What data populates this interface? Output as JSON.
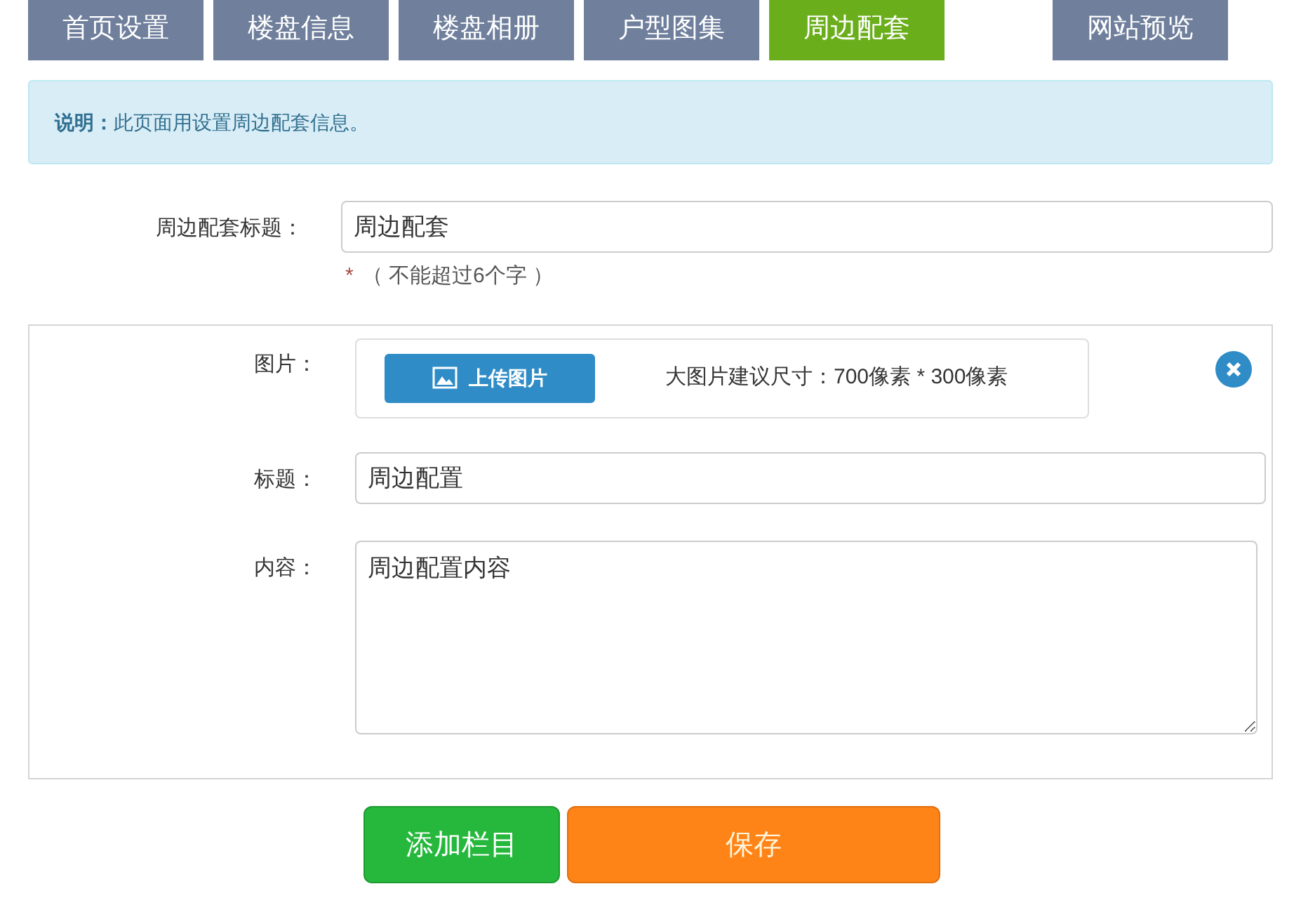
{
  "tabs": [
    {
      "label": "首页设置",
      "selected": false
    },
    {
      "label": "楼盘信息",
      "selected": false
    },
    {
      "label": "楼盘相册",
      "selected": false
    },
    {
      "label": "户型图集",
      "selected": false
    },
    {
      "label": "周边配套",
      "selected": true
    }
  ],
  "preview_tab": {
    "label": "网站预览"
  },
  "notice": {
    "label": "说明：",
    "text": "此页面用设置周边配套信息。"
  },
  "section_title": {
    "label": "周边配套标题：",
    "value": "周边配套",
    "required_mark": "*",
    "hint": "（ 不能超过6个字 ）"
  },
  "item": {
    "image_label": "图片：",
    "upload_button": "上传图片",
    "image_hint": "大图片建议尺寸：700像素 * 300像素",
    "title_label": "标题：",
    "title_value": "周边配置",
    "content_label": "内容：",
    "content_value": "周边配置内容"
  },
  "buttons": {
    "add": "添加栏目",
    "save": "保存"
  }
}
